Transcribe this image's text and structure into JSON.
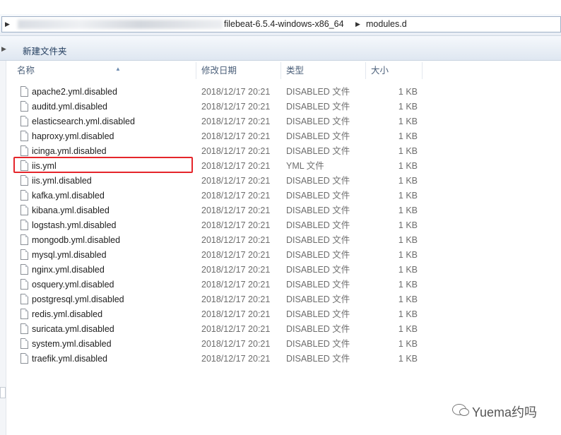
{
  "address_bar": {
    "crumbs": [
      "filebeat-6.5.4-windows-x86_64",
      "modules.d"
    ],
    "separator_icon": "triangle-right-icon"
  },
  "toolbar": {
    "new_folder_label": "新建文件夹"
  },
  "columns": {
    "name": "名称",
    "date": "修改日期",
    "type": "类型",
    "size": "大小",
    "sort_icon": "sort-up-arrow-icon"
  },
  "files": [
    {
      "name": "apache2.yml.disabled",
      "date": "2018/12/17 20:21",
      "type": "DISABLED 文件",
      "size": "1 KB"
    },
    {
      "name": "auditd.yml.disabled",
      "date": "2018/12/17 20:21",
      "type": "DISABLED 文件",
      "size": "1 KB"
    },
    {
      "name": "elasticsearch.yml.disabled",
      "date": "2018/12/17 20:21",
      "type": "DISABLED 文件",
      "size": "1 KB"
    },
    {
      "name": "haproxy.yml.disabled",
      "date": "2018/12/17 20:21",
      "type": "DISABLED 文件",
      "size": "1 KB"
    },
    {
      "name": "icinga.yml.disabled",
      "date": "2018/12/17 20:21",
      "type": "DISABLED 文件",
      "size": "1 KB"
    },
    {
      "name": "iis.yml",
      "date": "2018/12/17 20:21",
      "type": "YML 文件",
      "size": "1 KB"
    },
    {
      "name": "iis.yml.disabled",
      "date": "2018/12/17 20:21",
      "type": "DISABLED 文件",
      "size": "1 KB"
    },
    {
      "name": "kafka.yml.disabled",
      "date": "2018/12/17 20:21",
      "type": "DISABLED 文件",
      "size": "1 KB"
    },
    {
      "name": "kibana.yml.disabled",
      "date": "2018/12/17 20:21",
      "type": "DISABLED 文件",
      "size": "1 KB"
    },
    {
      "name": "logstash.yml.disabled",
      "date": "2018/12/17 20:21",
      "type": "DISABLED 文件",
      "size": "1 KB"
    },
    {
      "name": "mongodb.yml.disabled",
      "date": "2018/12/17 20:21",
      "type": "DISABLED 文件",
      "size": "1 KB"
    },
    {
      "name": "mysql.yml.disabled",
      "date": "2018/12/17 20:21",
      "type": "DISABLED 文件",
      "size": "1 KB"
    },
    {
      "name": "nginx.yml.disabled",
      "date": "2018/12/17 20:21",
      "type": "DISABLED 文件",
      "size": "1 KB"
    },
    {
      "name": "osquery.yml.disabled",
      "date": "2018/12/17 20:21",
      "type": "DISABLED 文件",
      "size": "1 KB"
    },
    {
      "name": "postgresql.yml.disabled",
      "date": "2018/12/17 20:21",
      "type": "DISABLED 文件",
      "size": "1 KB"
    },
    {
      "name": "redis.yml.disabled",
      "date": "2018/12/17 20:21",
      "type": "DISABLED 文件",
      "size": "1 KB"
    },
    {
      "name": "suricata.yml.disabled",
      "date": "2018/12/17 20:21",
      "type": "DISABLED 文件",
      "size": "1 KB"
    },
    {
      "name": "system.yml.disabled",
      "date": "2018/12/17 20:21",
      "type": "DISABLED 文件",
      "size": "1 KB"
    },
    {
      "name": "traefik.yml.disabled",
      "date": "2018/12/17 20:21",
      "type": "DISABLED 文件",
      "size": "1 KB"
    }
  ],
  "highlighted_file": "iis.yml",
  "highlight_color": "#e5262b",
  "watermark": {
    "text": "Yuema约吗",
    "icon": "wechat-icon"
  }
}
